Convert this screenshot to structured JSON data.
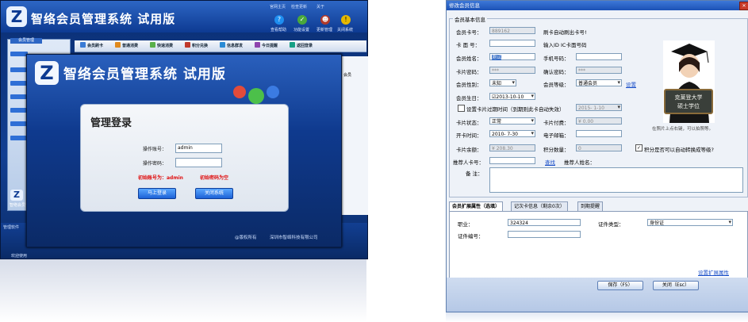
{
  "main_window": {
    "app_title": "智络会员管理系统",
    "edition": "试用版",
    "top_links": [
      "官网主页",
      "检查更新",
      "关于"
    ],
    "top_icons": [
      {
        "label": "查看帮助",
        "icon": "help-icon"
      },
      {
        "label": "功能设置",
        "icon": "settings-icon"
      },
      {
        "label": "更新管理",
        "icon": "user-icon"
      },
      {
        "label": "关闭系统",
        "icon": "warning-icon"
      }
    ],
    "sidebar_header": "会员管理",
    "toolbar": [
      "会员刷卡",
      "普通消费",
      "快速消费",
      "积分兑换",
      "信息群发",
      "今日提醒",
      "返回登录"
    ],
    "right_panel_text": "会员",
    "status_left": "管理软件",
    "status_bottom": "欢迎使用"
  },
  "login_dialog": {
    "title": "智络会员管理系统",
    "edition": "试用版",
    "heading": "管理登录",
    "account_label": "操作账号：",
    "account_value": "admin",
    "password_label": "操作密码：",
    "password_value": "",
    "hint_account": "初始账号为：admin",
    "hint_password": "初始密码为空",
    "login_button": "马上登录",
    "close_button": "关闭系统",
    "copyright": "@版权所有",
    "company": "深圳市智络科技有限公司"
  },
  "member_dialog": {
    "title": "修改会员信息",
    "group_title": "会员基本信息",
    "card_no_label": "会员卡号：",
    "card_no_value": "889162",
    "swipe_hint": "刷卡自动刷出卡号!",
    "face_no_label": "卡 面 号：",
    "face_hint": "输入ID IC卡面号码",
    "name_label": "会员姓名：",
    "name_value": "测试",
    "phone_label": "手机号码：",
    "phone_value": "",
    "pwd_label": "卡片密码：",
    "pwd_value": "***",
    "confirm_label": "确认密码：",
    "confirm_value": "***",
    "gender_label": "会员性别：",
    "gender_value": "未知",
    "level_label": "会员等级：",
    "level_value": "普通会员",
    "level_link": "设置",
    "birthday_label": "会员生日：",
    "birthday_value": "2013-10-10",
    "expire_label": "设置卡片过期时间（到期则此卡自动失效）",
    "expire_value": "2015- 1-10",
    "status_label": "卡片状态：",
    "status_value": "正常",
    "fee_label": "卡片付费：",
    "fee_value": "¥ 0.00",
    "open_label": "开卡时间：",
    "open_value": "2010- 7-30",
    "email_label": "电子邮箱：",
    "email_value": "",
    "balance_label": "卡片余额：",
    "balance_value": "¥ 208.30",
    "points_label": "积分数量：",
    "points_value": "0",
    "auto_points_label": "积分是否可以自动转换成等级?",
    "referrer_label": "推荐人卡号：",
    "referrer_value": "",
    "lookup_link": "查找",
    "referrer_name_label": "推荐人姓名：",
    "notes_label": "备  注：",
    "photo_caption": "在照片上点右键，可以拍照等。",
    "photo_board_line1": "克莱登大学",
    "photo_board_line2": "硕士学位",
    "tabs": [
      "会员扩展属性（选填）",
      "记次卡信息（剩余0次）",
      "到期提醒"
    ],
    "job_label": "职业：",
    "job_value": "324324",
    "id_type_label": "证件类型：",
    "id_type_value": "身份证",
    "id_no_label": "证件编号：",
    "id_no_value": "",
    "extend_link": "设置扩展属性",
    "save_button": "保存（F5）",
    "close_button": "关闭（Esc）"
  },
  "colors": {
    "left_bg": "#123f92",
    "login_red": "#e01010",
    "button_blue": "#1d62d6",
    "right_title": "#1c52b6",
    "link_blue": "#1a4fc8"
  }
}
